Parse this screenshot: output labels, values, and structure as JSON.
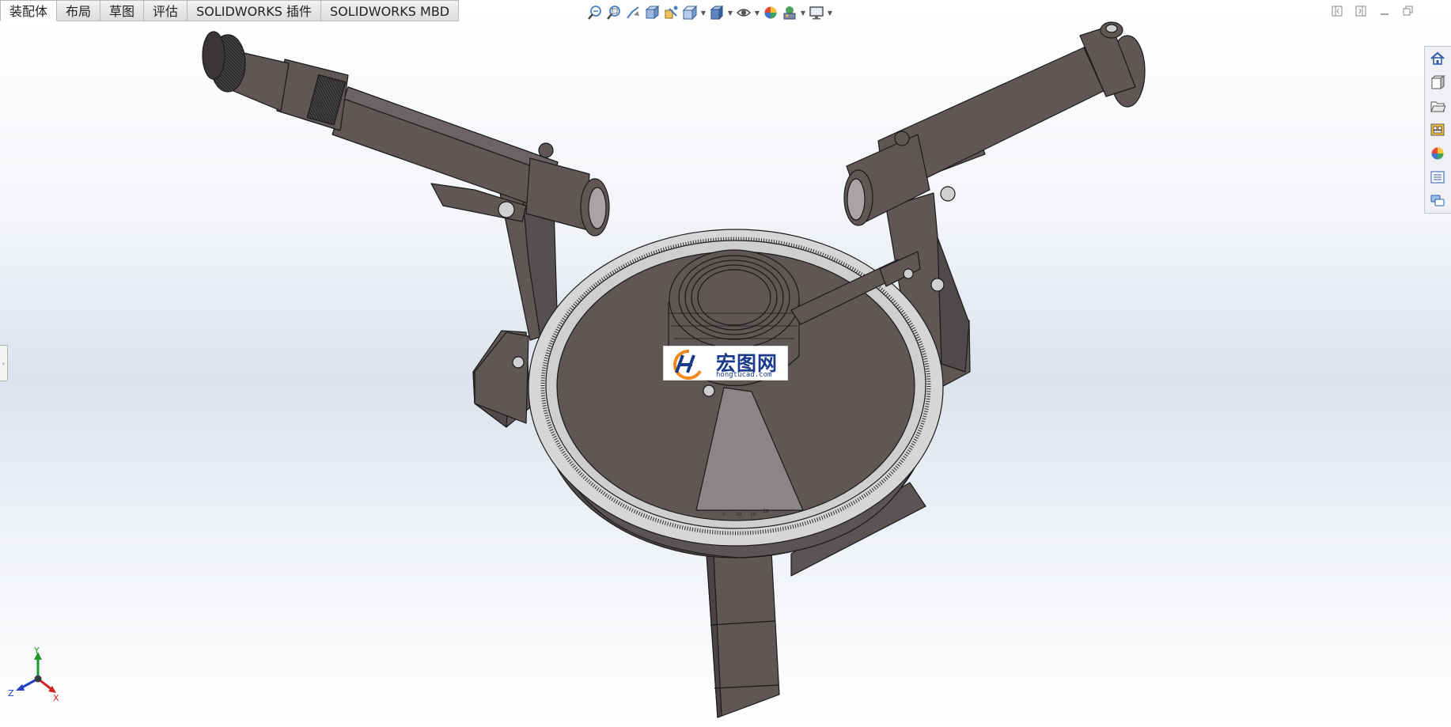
{
  "command_tabs": [
    "装配体",
    "布局",
    "草图",
    "评估",
    "SOLIDWORKS 插件",
    "SOLIDWORKS MBD"
  ],
  "heads_up_toolbar": {
    "items": [
      "zoom-to-fit-icon",
      "zoom-to-area-icon",
      "previous-view-icon",
      "section-view-icon",
      "dynamic-annotation-icon",
      "view-orientation-icon",
      "display-style-icon",
      "hide-show-items-icon",
      "edit-appearance-icon",
      "apply-scene-icon",
      "view-settings-icon"
    ]
  },
  "task_pane": {
    "items": [
      "solidworks-resources-icon",
      "design-library-icon",
      "file-explorer-icon",
      "view-palette-icon",
      "appearances-scenes-icon",
      "custom-properties-icon",
      "forum-icon"
    ]
  },
  "watermark": {
    "title": "宏图网",
    "url": "hongtucad.com"
  },
  "triad": {
    "x": "X",
    "y": "Y",
    "z": "Z"
  },
  "dial_labels": {
    "vernier": [
      "0",
      "10",
      "20",
      "30"
    ]
  },
  "colors": {
    "model_gray": "#5e5756",
    "scale_ring": "#d7d6d6",
    "triad_x": "#d22020",
    "triad_y": "#1c9a2a",
    "triad_z": "#2040c8",
    "watermark_blue": "#1a3a8a",
    "watermark_orange": "#f08a1c"
  }
}
